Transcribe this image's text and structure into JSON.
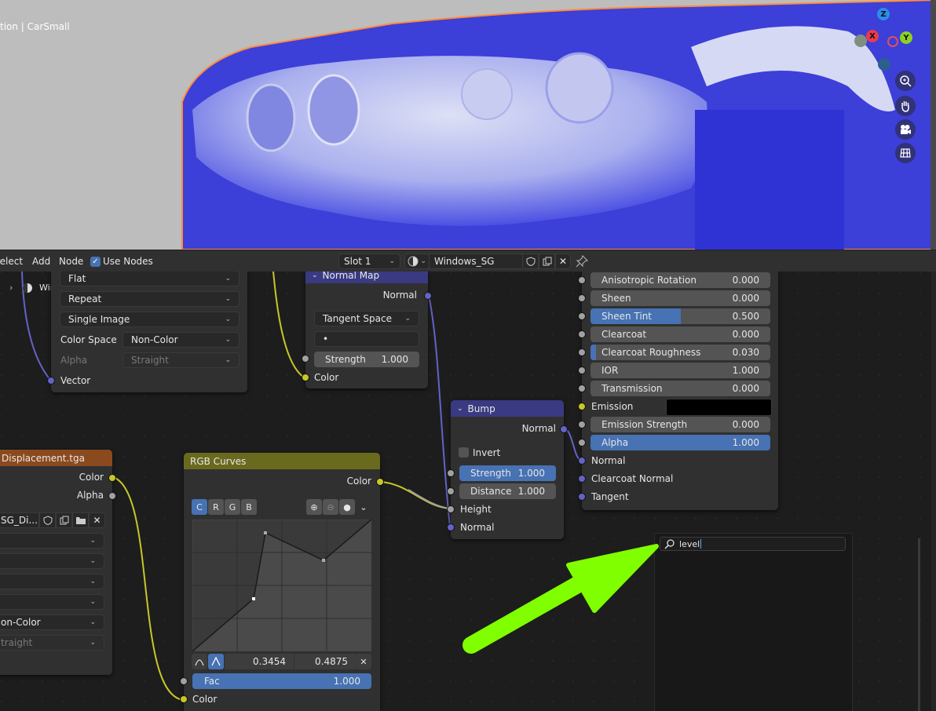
{
  "viewport": {
    "object_label": "tion | CarSmall",
    "gizmo": {
      "z": "Z",
      "x": "X",
      "y": "Y"
    },
    "tools": [
      "zoom-icon",
      "hand-icon",
      "camera-icon",
      "grid-icon"
    ]
  },
  "header": {
    "menu": [
      "Select",
      "Add",
      "Node"
    ],
    "use_nodes_label": "Use Nodes",
    "use_nodes_checked": true,
    "slot": "Slot 1",
    "material": "Windows_SG"
  },
  "outliner_fragment": {
    "label": "Windows_SG"
  },
  "image_node_top": {
    "interpolation": "Flat",
    "extension": "Repeat",
    "source": "Single Image",
    "color_space_label": "Color Space",
    "color_space": "Non-Color",
    "alpha_label": "Alpha",
    "alpha": "Straight",
    "vector_label": "Vector"
  },
  "normal_map_node": {
    "title": "Normal Map",
    "output": "Normal",
    "space": "Tangent Space",
    "uv": "•",
    "strength_label": "Strength",
    "strength": "1.000",
    "color_label": "Color"
  },
  "bsdf_node": {
    "rows": [
      {
        "label": "Anisotropic Rotation",
        "value": "0.000",
        "fill": 0
      },
      {
        "label": "Sheen",
        "value": "0.000",
        "fill": 0
      },
      {
        "label": "Sheen Tint",
        "value": "0.500",
        "fill": 0.5
      },
      {
        "label": "Clearcoat",
        "value": "0.000",
        "fill": 0
      },
      {
        "label": "Clearcoat Roughness",
        "value": "0.030",
        "fill": 0.03
      },
      {
        "label": "IOR",
        "value": "1.000",
        "fill": 0
      },
      {
        "label": "Transmission",
        "value": "0.000",
        "fill": 0
      }
    ],
    "emission_label": "Emission",
    "emission_color": "#000000",
    "emission_strength_label": "Emission Strength",
    "emission_strength": "0.000",
    "alpha_label": "Alpha",
    "alpha": "1.000",
    "normal_label": "Normal",
    "clearcoat_normal_label": "Clearcoat Normal",
    "tangent_label": "Tangent"
  },
  "bump_node": {
    "title": "Bump",
    "output": "Normal",
    "invert_label": "Invert",
    "strength_label": "Strength",
    "strength": "1.000",
    "distance_label": "Distance",
    "distance": "1.000",
    "height_label": "Height",
    "normal_label": "Normal"
  },
  "displacement_node": {
    "title": "Displacement.tga",
    "color_label": "Color",
    "alpha_label": "Alpha",
    "image_name": "SG_Di...",
    "color_space": "on-Color",
    "alpha": "traight"
  },
  "rgb_curves_node": {
    "title": "RGB Curves",
    "output": "Color",
    "channels": [
      "C",
      "R",
      "G",
      "B"
    ],
    "point_x": "0.3454",
    "point_y": "0.4875",
    "fac_label": "Fac",
    "fac": "1.000",
    "color_label": "Color"
  },
  "search": {
    "query": "level"
  },
  "colors": {
    "accent": "#4772b3",
    "socket_yellow": "#c7c729",
    "socket_blue": "#6363c7",
    "socket_gray": "#a1a1a1",
    "arrow": "#80ff00",
    "normal_map_header": "#3a3a82",
    "curves_header": "#6a6a1e",
    "image_header": "#8a4a1e"
  }
}
